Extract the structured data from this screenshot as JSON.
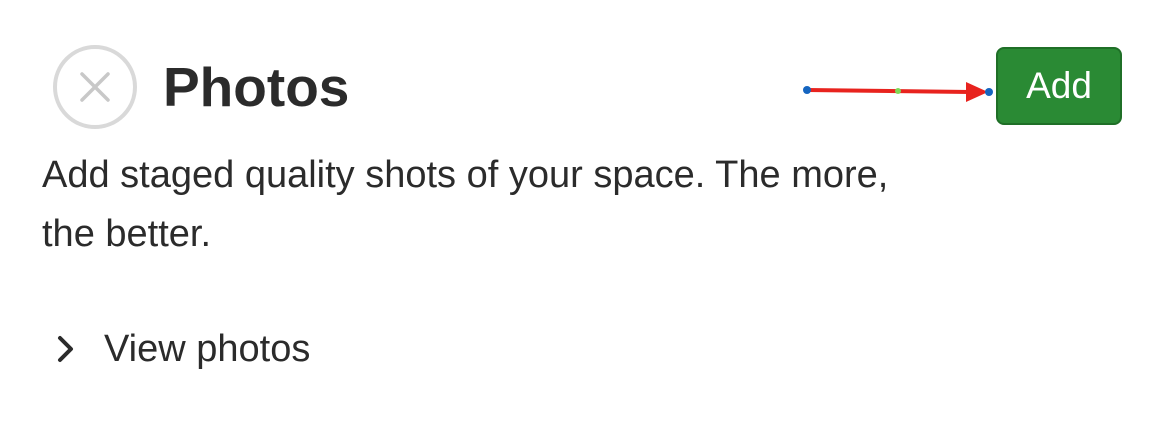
{
  "section": {
    "title": "Photos",
    "description": "Add staged quality shots of your space. The more, the better.",
    "status_icon": "circle-x-icon",
    "view_link": {
      "label": "View photos",
      "icon": "chevron-right-icon"
    },
    "add_button": {
      "label": "Add",
      "color": "#2a8a34"
    }
  },
  "annotation": {
    "type": "arrow",
    "color": "#e8231e",
    "points_to": "add-button"
  },
  "colors": {
    "text": "#2b2b2b",
    "icon_outline": "#d9d9d9",
    "button_bg": "#2a8a34",
    "button_text": "#ffffff"
  }
}
